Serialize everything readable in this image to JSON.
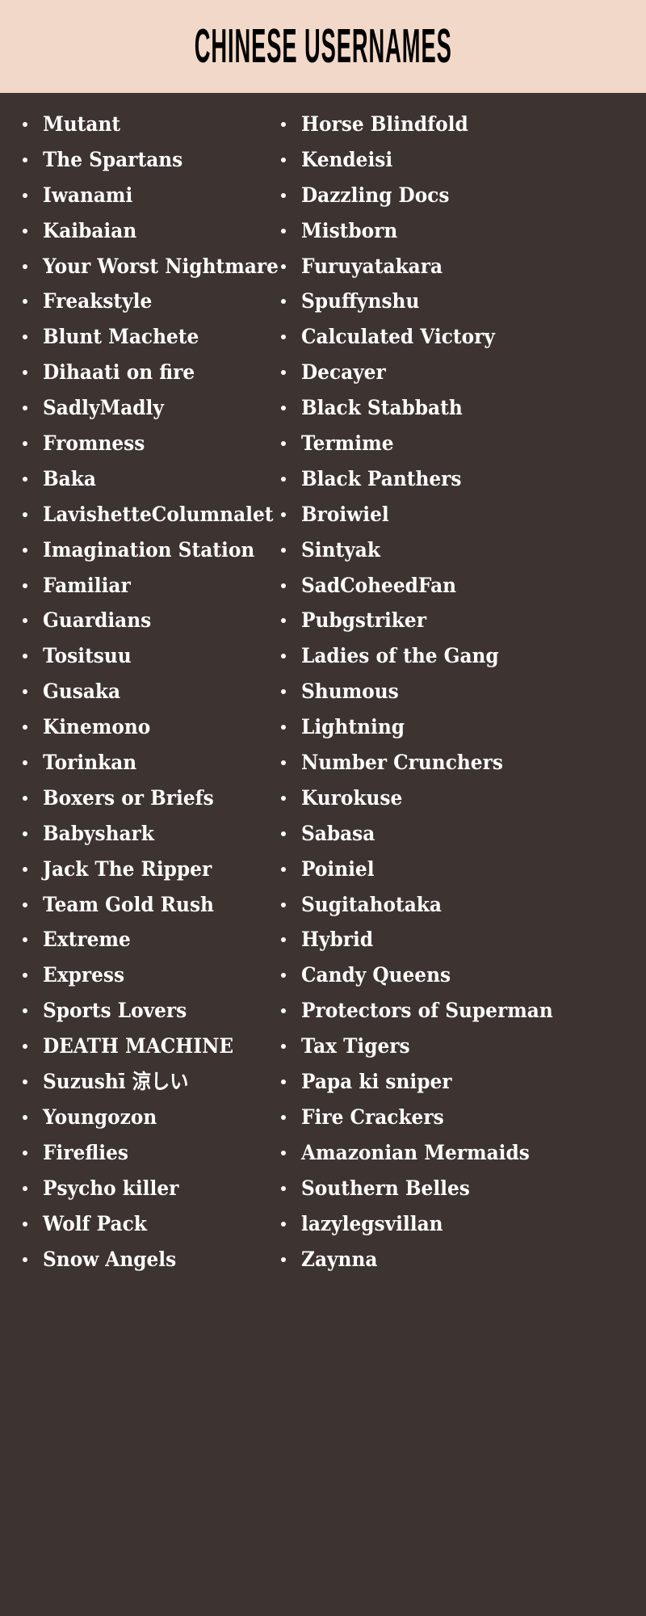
{
  "header": {
    "title": "CHINESE USERNAMES",
    "background_color": "#f2d8c8",
    "text_color": "#000000"
  },
  "body": {
    "background_color": "#3d3330",
    "text_color": "#fdfdfb",
    "bullet": "•"
  },
  "columns": {
    "left": [
      {
        "label": "Mutant"
      },
      {
        "label": "The Spartans"
      },
      {
        "label": "Iwanami"
      },
      {
        "label": "Kaibaian"
      },
      {
        "label": "Your Worst Nightmare"
      },
      {
        "label": "Freakstyle"
      },
      {
        "label": "Blunt Machete"
      },
      {
        "label": "Dihaati on fire"
      },
      {
        "label": "SadlyMadly"
      },
      {
        "label": "Fromness"
      },
      {
        "label": "Baka"
      },
      {
        "label": "LavishetteColumnalet"
      },
      {
        "label": "Imagination Station"
      },
      {
        "label": "Familiar"
      },
      {
        "label": "Guardians"
      },
      {
        "label": "Tositsuu"
      },
      {
        "label": "Gusaka"
      },
      {
        "label": "Kinemono"
      },
      {
        "label": "Torinkan"
      },
      {
        "label": "Boxers or Briefs"
      },
      {
        "label": "Babyshark"
      },
      {
        "label": "Jack The Ripper"
      },
      {
        "label": "Team Gold Rush"
      },
      {
        "label": "Extreme"
      },
      {
        "label": "Express"
      },
      {
        "label": "Sports Lovers"
      },
      {
        "label": "DEATH MACHINE"
      },
      {
        "label": "Suzushī 涼しい"
      },
      {
        "label": "Youngozon"
      },
      {
        "label": "Fireflies"
      },
      {
        "label": "Psycho killer"
      },
      {
        "label": "Wolf Pack"
      },
      {
        "label": "Snow Angels"
      }
    ],
    "right": [
      {
        "label": "Horse Blindfold"
      },
      {
        "label": "Kendeisi"
      },
      {
        "label": "Dazzling Docs"
      },
      {
        "label": "Mistborn"
      },
      {
        "label": "Furuyatakara"
      },
      {
        "label": "Spuffynshu"
      },
      {
        "label": "Calculated Victory"
      },
      {
        "label": "Decayer"
      },
      {
        "label": "Black Stabbath"
      },
      {
        "label": "Termime"
      },
      {
        "label": "Black Panthers"
      },
      {
        "label": "Broiwiel"
      },
      {
        "label": "Sintyak"
      },
      {
        "label": "SadCoheedFan"
      },
      {
        "label": "Pubgstriker"
      },
      {
        "label": "Ladies of the Gang"
      },
      {
        "label": "Shumous"
      },
      {
        "label": "Lightning"
      },
      {
        "label": "Number Crunchers"
      },
      {
        "label": "Kurokuse"
      },
      {
        "label": "Sabasa"
      },
      {
        "label": "Poiniel"
      },
      {
        "label": "Sugitahotaka"
      },
      {
        "label": "Hybrid"
      },
      {
        "label": "Candy Queens"
      },
      {
        "label": "Protectors of Superman"
      },
      {
        "label": "Tax Tigers"
      },
      {
        "label": "Papa ki sniper"
      },
      {
        "label": "Fire Crackers"
      },
      {
        "label": "Amazonian Mermaids"
      },
      {
        "label": "Southern Belles"
      },
      {
        "label": "lazylegsvillan"
      },
      {
        "label": "Zaynna"
      }
    ]
  }
}
